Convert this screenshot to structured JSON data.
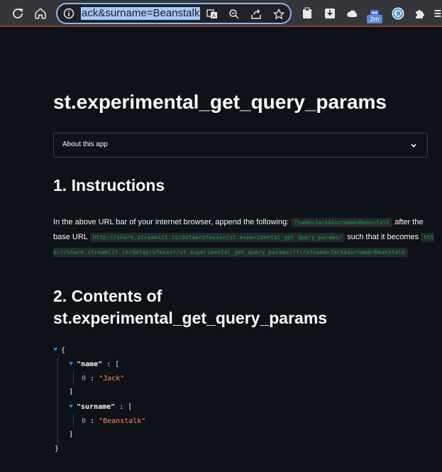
{
  "browser": {
    "url_text": "ack&surname=Beanstalk",
    "extension_badge": "2m"
  },
  "app": {
    "title": "st.experimental_get_query_params",
    "expander_label": "About this app",
    "section1_heading": "1. Instructions",
    "instructions": {
      "part1": "In the above URL bar of your internet browser, append the following:",
      "code1": "?name=Jack&surname=Beanstalk",
      "part2": "after the base URL",
      "code2": "http://share.streamlit.io/dataprofessor/st.experimental_get_query_params/",
      "part3": "such that it becomes",
      "code3": "http://share.streamlit.io/dataprofessor/st.experimental_get_query_params/?firstname=Jack&surname=Beanstalk"
    },
    "section2_heading_line1": "2. Contents of",
    "section2_heading_line2": "st.experimental_get_query_params",
    "json": {
      "open_brace": "{",
      "close_brace": "}",
      "key_name": "\"name\"",
      "key_surname": "\"surname\"",
      "sep": ":",
      "open_bracket": "[",
      "close_bracket": "]",
      "index0": "0",
      "val_name": "\"Jack\"",
      "val_surname": "\"Beanstalk\""
    }
  }
}
